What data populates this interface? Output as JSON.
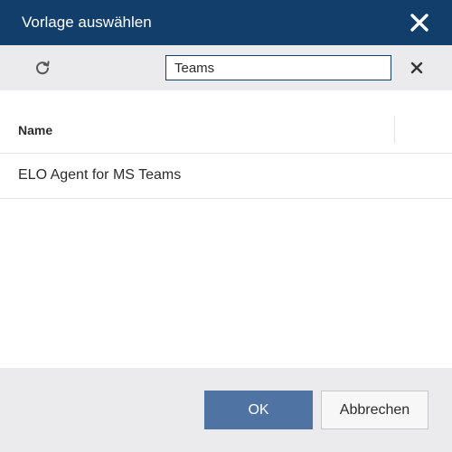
{
  "dialog": {
    "title": "Vorlage auswählen"
  },
  "toolbar": {
    "search_value": "Teams",
    "refresh_icon": "refresh-icon",
    "clear_icon": "close-icon"
  },
  "table": {
    "columns": [
      "Name"
    ],
    "rows": [
      {
        "name": "ELO Agent for MS Teams"
      }
    ]
  },
  "footer": {
    "ok_label": "OK",
    "cancel_label": "Abbrechen"
  },
  "colors": {
    "titlebar": "#123e6c",
    "primary_button": "#4f73a3",
    "toolbar_bg": "#ebebed"
  }
}
